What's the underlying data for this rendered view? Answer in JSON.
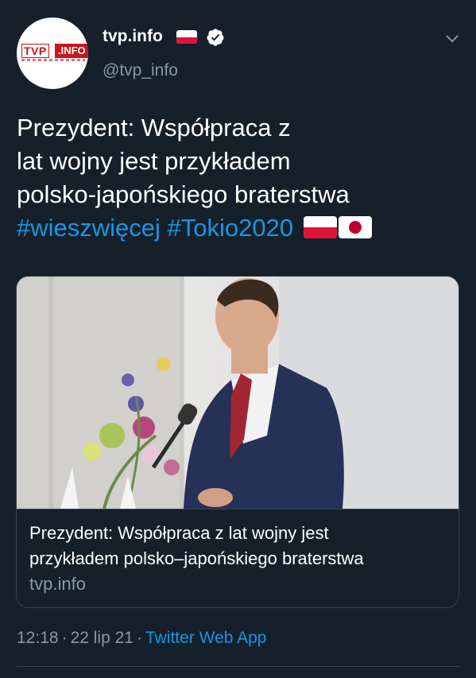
{
  "author": {
    "display_name": "tvp.info",
    "handle": "@tvp_info",
    "verified": true,
    "avatar_logo": {
      "part1": "TVP",
      "part2": ".INFO"
    }
  },
  "tweet": {
    "text_lines": [
      "Prezydent: Współpraca z",
      "lat wojny jest przykładem",
      "polsko-japońskiego braterstwa"
    ],
    "hashtags": [
      "#wieszwięcej",
      "#Tokio2020"
    ],
    "emoji": [
      "flag-poland",
      "flag-japan"
    ]
  },
  "card": {
    "title_lines": [
      "Prezydent: Współpraca z lat wojny jest",
      "przykładem polsko–japońskiego braterstwa"
    ],
    "domain": "tvp.info"
  },
  "meta": {
    "time": "12:18",
    "date": "22 lip 21",
    "separator": "·",
    "source": "Twitter Web App"
  },
  "colors": {
    "background": "#15202b",
    "link": "#1b95e0",
    "secondary_text": "#8899a6",
    "border": "#38444d"
  }
}
